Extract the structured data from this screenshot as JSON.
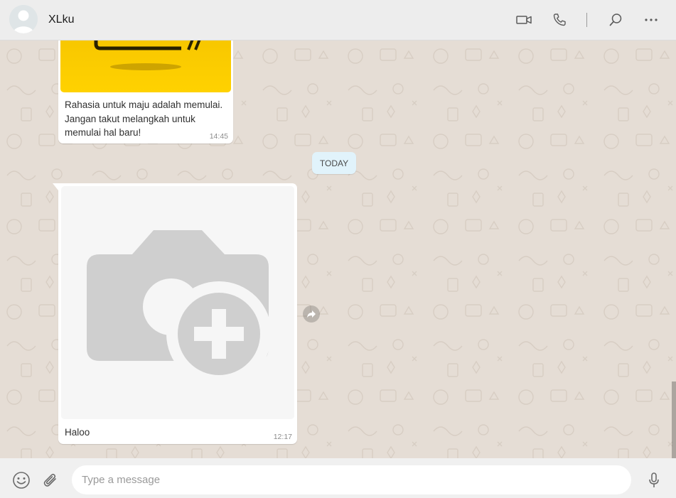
{
  "header": {
    "contact_name": "XLku",
    "icons": [
      "avatar-default-icon",
      "video-call-icon",
      "voice-call-icon",
      "search-icon",
      "more-options-icon"
    ]
  },
  "messages": [
    {
      "type": "image",
      "image_note": "yellow-promo-image",
      "caption": "Rahasia untuk maju adalah memulai. Jangan takut melangkah untuk memulai hal baru!",
      "time": "14:45"
    },
    {
      "type": "image",
      "image_note": "camera-plus-placeholder-icon",
      "caption": "Haloo",
      "time": "12:17"
    }
  ],
  "date_separator": "TODAY",
  "composer": {
    "placeholder": "Type a message",
    "value": "",
    "icons": [
      "emoji-icon",
      "attach-icon",
      "microphone-icon"
    ]
  },
  "colors": {
    "header_bg": "#ededed",
    "chat_bg": "#e5ddd5",
    "bubble_bg": "#ffffff",
    "date_chip_bg": "#e1f3fb",
    "promo_yellow": "#ffd200"
  }
}
